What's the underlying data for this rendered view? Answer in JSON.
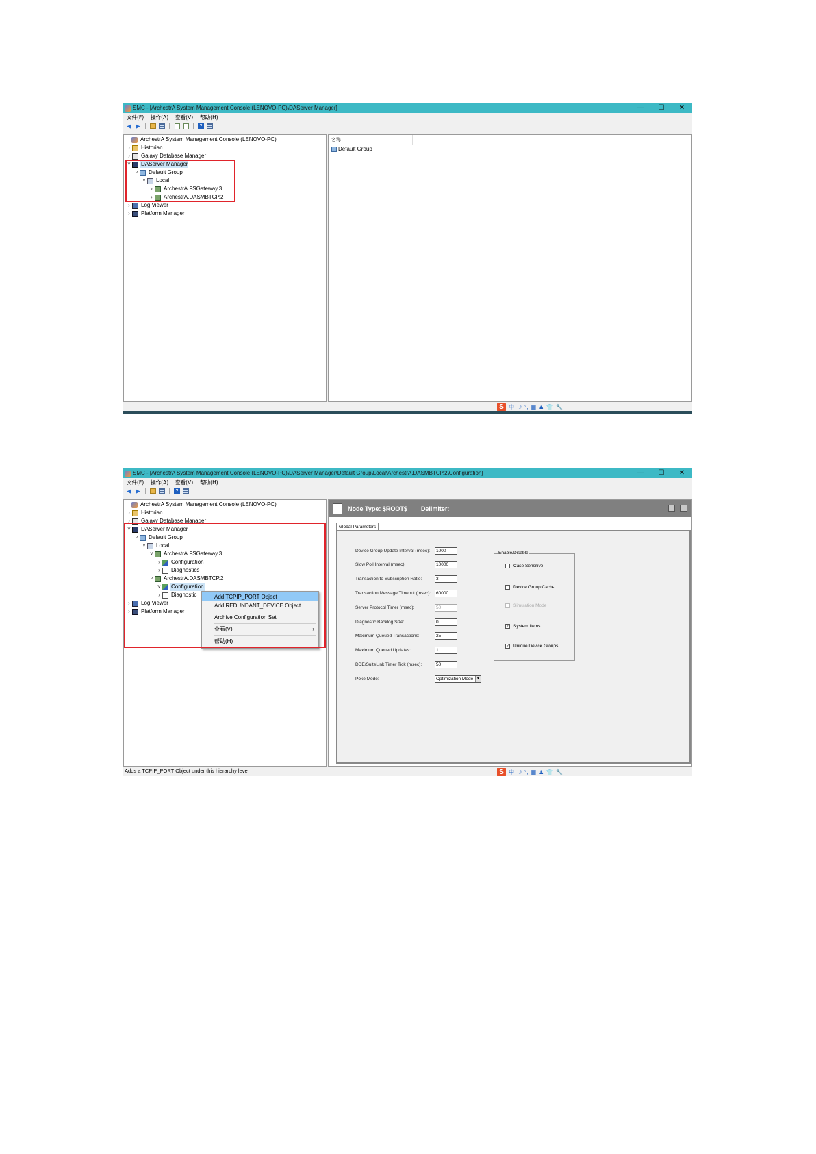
{
  "common": {
    "menu": [
      "文件(F)",
      "操作(A)",
      "查看(V)",
      "帮助(H)"
    ],
    "win_controls": [
      "—",
      "☐",
      "✕"
    ],
    "ime": [
      "S",
      "中",
      "☽",
      "°,",
      "▦",
      "♟",
      "👕",
      "🔧"
    ]
  },
  "win1": {
    "title": "SMC - [ArchestrA System Management Console (LENOVO-PC)\\DAServer Manager]",
    "tree": {
      "root": "ArchestrA System Management Console (LENOVO-PC)",
      "historian": "Historian",
      "galaxy": "Galaxy Database Manager",
      "daserver": "DAServer Manager",
      "default_group": "Default Group",
      "local": "Local",
      "fsgateway": "ArchestrA.FSGateway.3",
      "dasmbtcp": "ArchestrA.DASMBTCP.2",
      "log_viewer": "Log Viewer",
      "platform": "Platform Manager"
    },
    "list": {
      "header": "名称",
      "item": "Default Group"
    }
  },
  "win2": {
    "title": "SMC - [ArchestrA System Management Console (LENOVO-PC)\\DAServer Manager\\Default Group\\Local\\ArchestrA.DASMBTCP.2\\Configuration]",
    "tree": {
      "root": "ArchestrA System Management Console (LENOVO-PC)",
      "historian": "Historian",
      "galaxy": "Galaxy Database Manager",
      "daserver": "DAServer Manager",
      "default_group": "Default Group",
      "local": "Local",
      "fsgateway": "ArchestrA.FSGateway.3",
      "fs_config": "Configuration",
      "fs_diag": "Diagnostics",
      "dasmbtcp": "ArchestrA.DASMBTCP.2",
      "mb_config": "Configuration",
      "mb_diag": "Diagnostic",
      "log_viewer": "Log Viewer",
      "platform": "Platform Manager"
    },
    "context_menu": {
      "add_tcpip": "Add TCPIP_PORT Object",
      "add_redundant": "Add REDUNDANT_DEVICE Object",
      "archive": "Archive Configuration Set",
      "view": "查看(V)",
      "help": "帮助(H)"
    },
    "config": {
      "node_type": "Node Type: $ROOT$",
      "delimiter": "Delimiter:",
      "tab": "Global Parameters",
      "params": [
        {
          "label": "Device Group Update Interval (msec):",
          "value": "1000"
        },
        {
          "label": "Slow Poll Interval (msec):",
          "value": "10000"
        },
        {
          "label": "Transaction to Subscription Ratio:",
          "value": "3"
        },
        {
          "label": "Transaction Message Timeout (msec):",
          "value": "60000"
        },
        {
          "label": "Server Protocol Timer (msec):",
          "value": "50"
        },
        {
          "label": "Diagnostic Backlog Size:",
          "value": "0"
        },
        {
          "label": "Maximum Queued Transactions:",
          "value": "25"
        },
        {
          "label": "Maximum Queued Updates:",
          "value": "1"
        },
        {
          "label": "DDE/SuiteLink Timer Tick (msec):",
          "value": "50"
        }
      ],
      "poke_label": "Poke Mode:",
      "poke_value": "Optimization Mode",
      "enable_title": "Enable/Disable",
      "checks": [
        {
          "label": "Case Sensitive",
          "checked": false
        },
        {
          "label": "Device Group Cache",
          "checked": false
        },
        {
          "label": "Simulation Mode",
          "checked": false
        },
        {
          "label": "System Items",
          "checked": true
        },
        {
          "label": "Unique Device Groups",
          "checked": true
        }
      ]
    },
    "status": "Adds a TCPIP_PORT Object under this hierarchy level"
  },
  "colors": {
    "titlebar": "#3db9c5",
    "highlight_box": "#e0242b",
    "config_header": "#808080",
    "menu_highlight": "#91c9f7"
  }
}
